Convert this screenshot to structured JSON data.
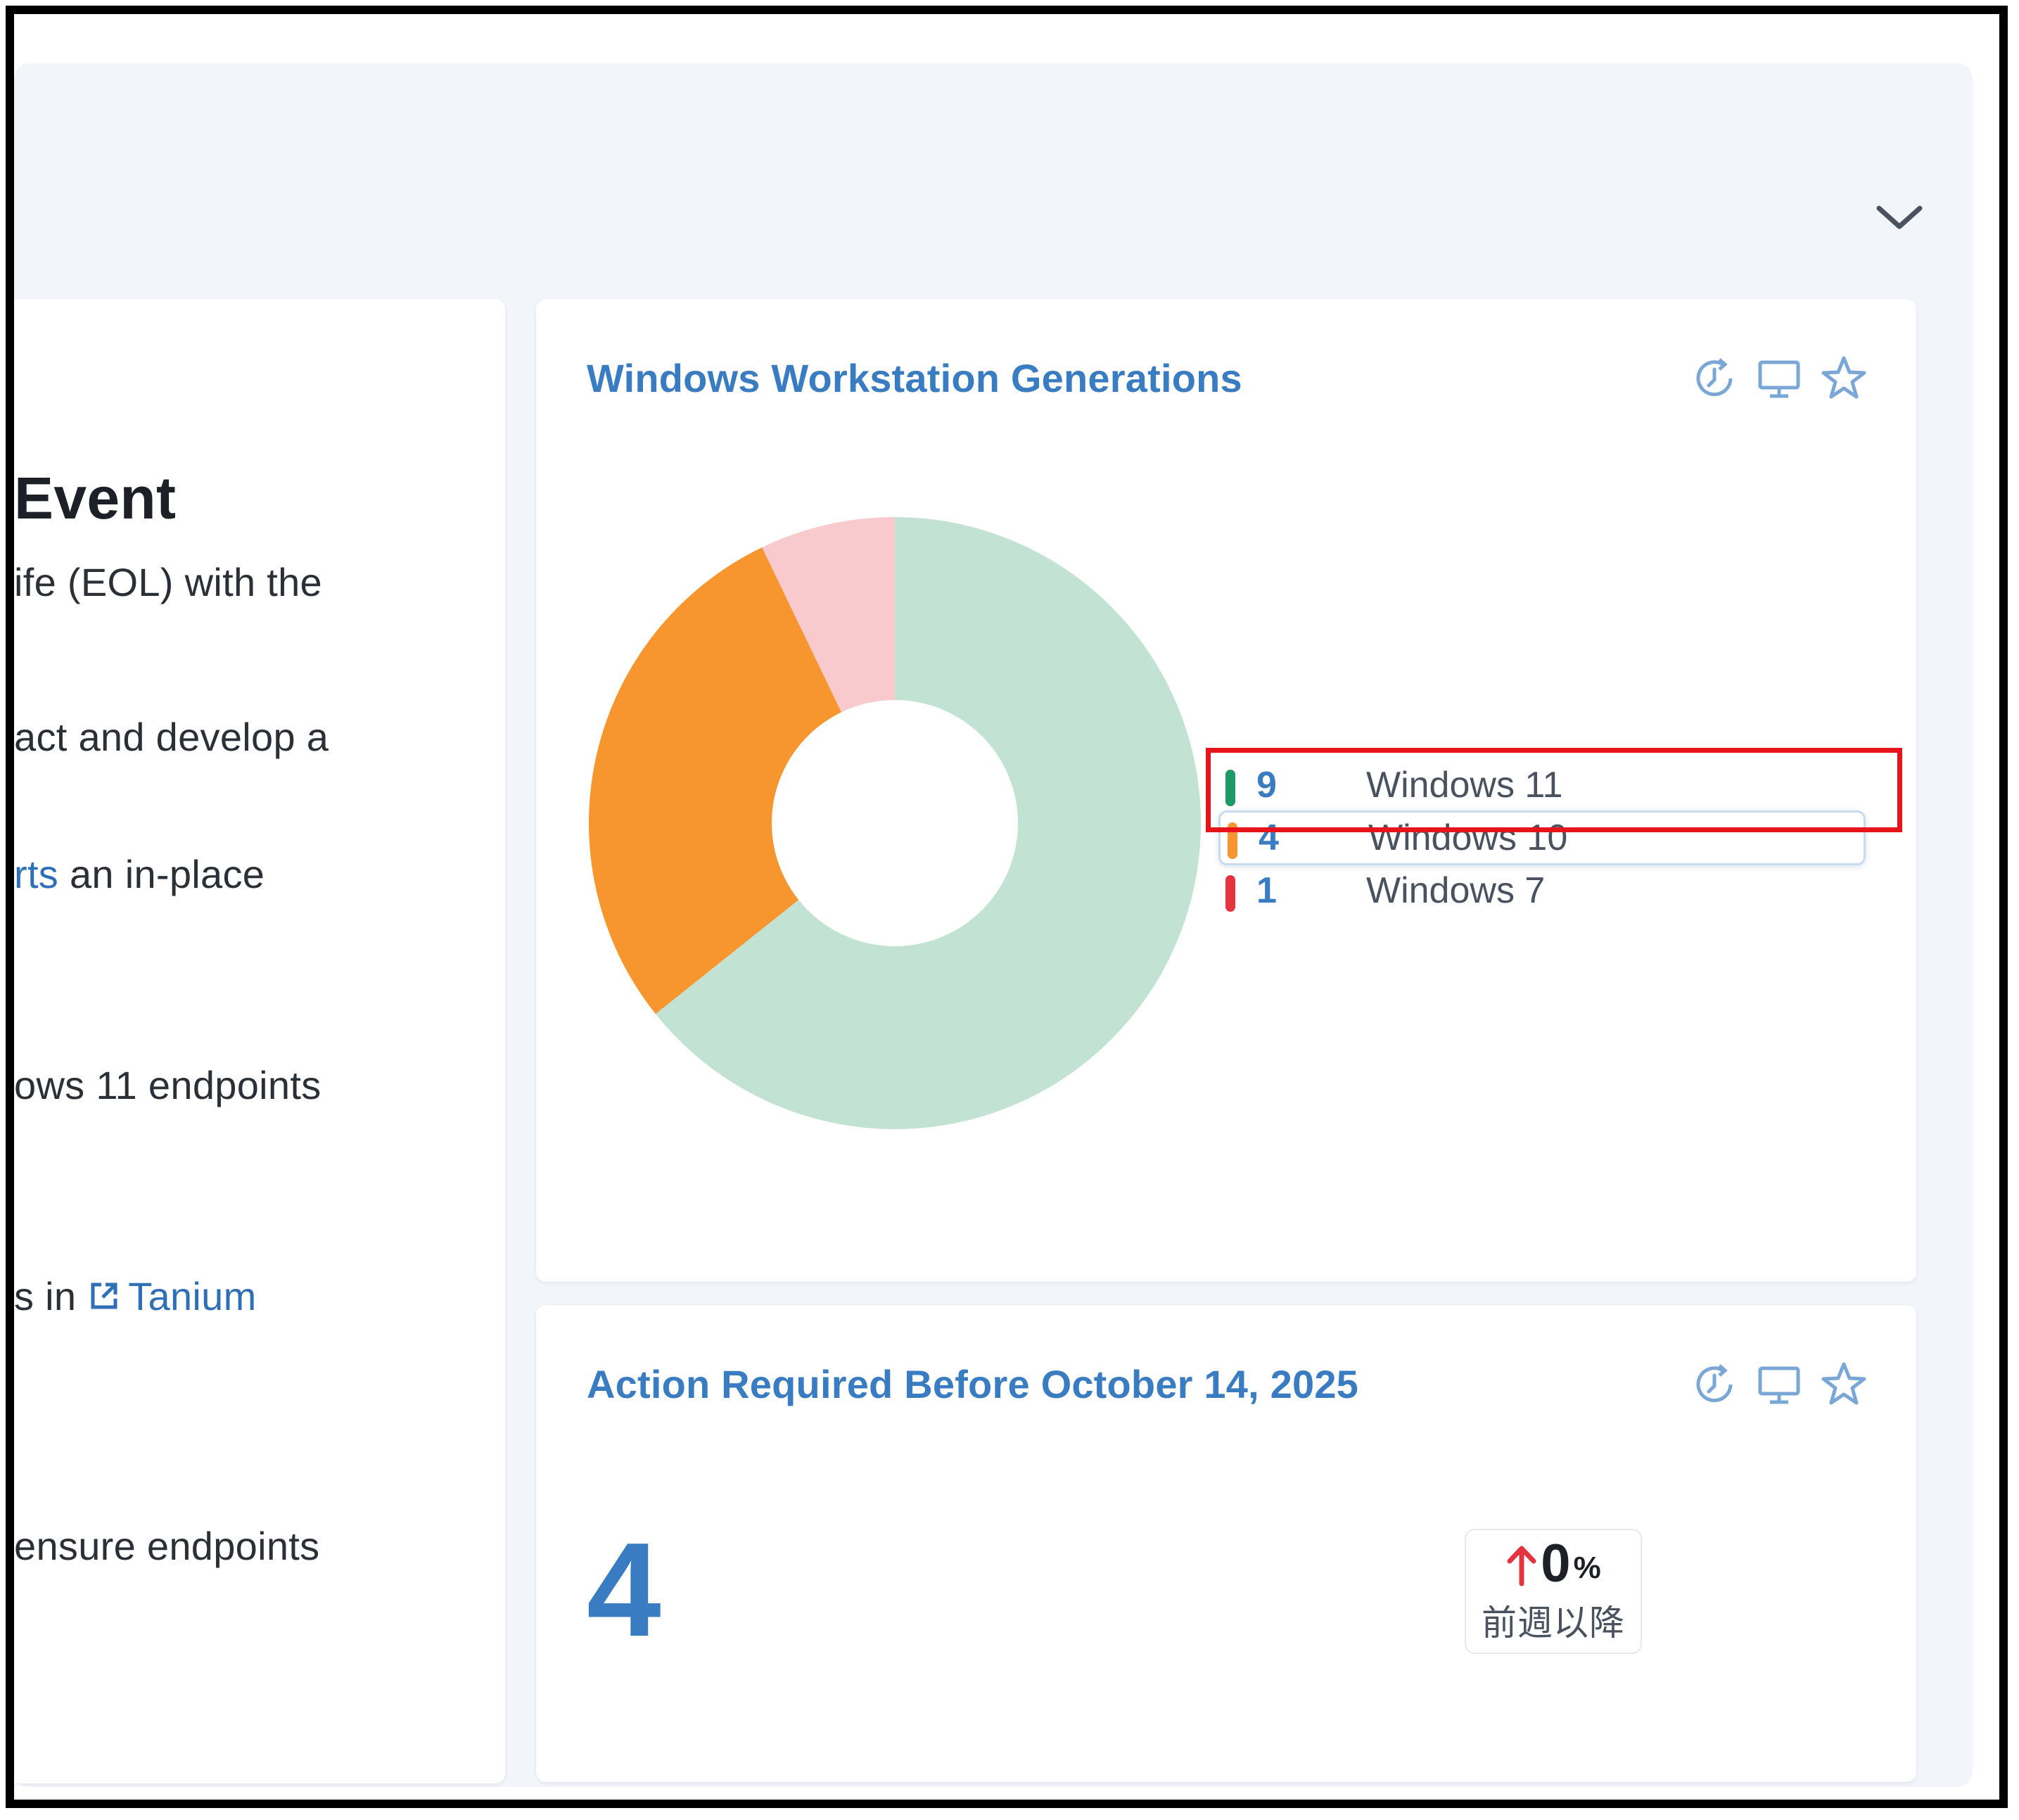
{
  "left_card": {
    "title": "Event",
    "lines": [
      "ife (EOL) with the",
      "act and develop a",
      "an in-place",
      "ows 11 endpoints",
      "s in ",
      "ensure endpoints"
    ],
    "link_rts": "rts",
    "link_tanium": "Tanium"
  },
  "chart_card": {
    "title": "Windows Workstation Generations",
    "tools": [
      "history-icon",
      "monitor-icon",
      "star-icon"
    ]
  },
  "chart_data": {
    "type": "pie",
    "categories": [
      "Windows 11",
      "Windows 10",
      "Windows 7"
    ],
    "values": [
      9,
      4,
      1
    ],
    "colors": [
      "#c2e2d3",
      "#f7962e",
      "#f8c9cd"
    ],
    "legend_colors": [
      "#1e9a64",
      "#f7962e",
      "#e3343f"
    ],
    "donut": true,
    "legend": "right",
    "highlighted": "Windows 10"
  },
  "action_card": {
    "title": "Action Required Before October 14, 2025",
    "value": "4",
    "change_value": "0",
    "change_unit": "%",
    "change_label": "前週以降",
    "change_color": "#e3343f",
    "tools": [
      "history-icon",
      "monitor-icon",
      "star-icon"
    ]
  },
  "colors": {
    "accent": "#3a7cc2",
    "panel_bg": "#f2f6fa",
    "highlight": "#e8141c"
  }
}
